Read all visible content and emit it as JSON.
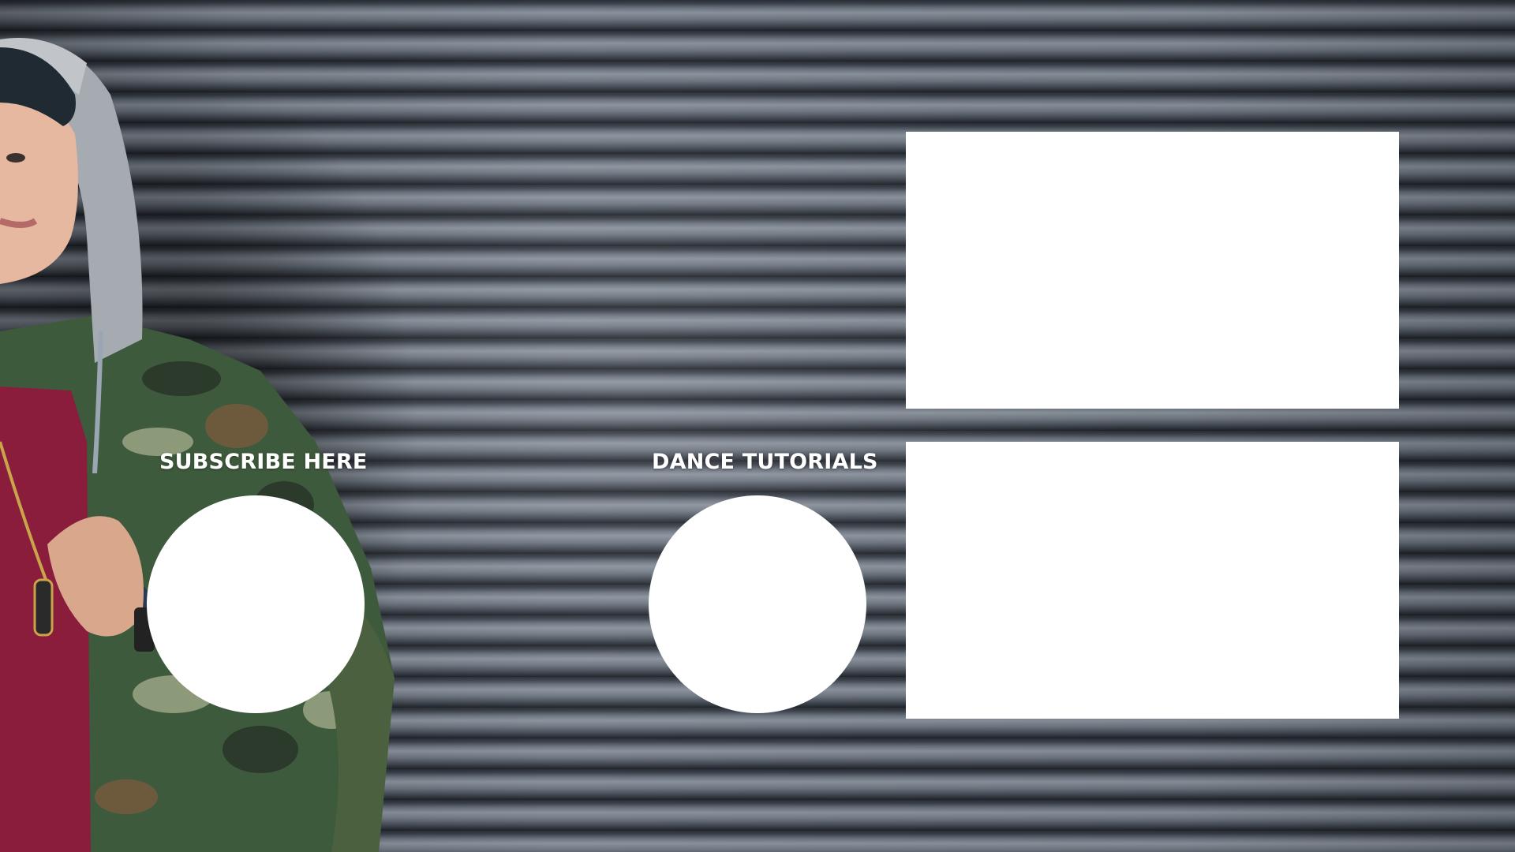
{
  "end_screen": {
    "subscribe_label": "SUBSCRIBE HERE",
    "playlist_label": "DANCE TUTORIALS"
  },
  "colors": {
    "placeholder_fill": "#ffffff",
    "label_text": "#ffffff",
    "shutter_base": "#4a515c",
    "shirt": "#8a1c3c",
    "hoodie": "#a6abb2",
    "camo_green": "#3e5a3c"
  }
}
